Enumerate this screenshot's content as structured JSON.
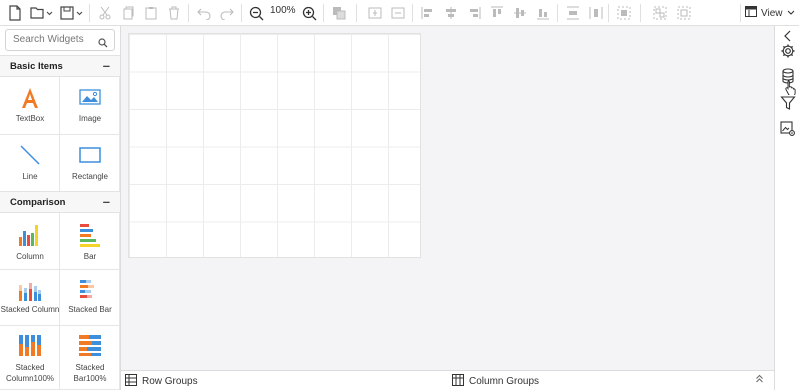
{
  "toolbar": {
    "zoom_level": "100%",
    "view_label": "View"
  },
  "widgets": {
    "search_placeholder": "Search Widgets",
    "sections": [
      {
        "title": "Basic Items",
        "items": [
          {
            "label": "TextBox",
            "icon": "textbox-icon"
          },
          {
            "label": "Image",
            "icon": "image-icon"
          },
          {
            "label": "Line",
            "icon": "line-icon"
          },
          {
            "label": "Rectangle",
            "icon": "rectangle-icon"
          }
        ]
      },
      {
        "title": "Comparison",
        "items": [
          {
            "label": "Column",
            "icon": "column-chart-icon"
          },
          {
            "label": "Bar",
            "icon": "bar-chart-icon"
          },
          {
            "label": "Stacked Column",
            "icon": "stacked-column-icon"
          },
          {
            "label": "Stacked Bar",
            "icon": "stacked-bar-icon"
          },
          {
            "label": "Stacked Column100%",
            "icon": "stacked-column-100-icon"
          },
          {
            "label": "Stacked Bar100%",
            "icon": "stacked-bar-100-icon"
          }
        ]
      }
    ]
  },
  "bottom_bar": {
    "row_groups": "Row Groups",
    "column_groups": "Column Groups"
  },
  "colors": {
    "accent_blue": "#3d8fdb",
    "orange": "#f07b24",
    "green": "#5cb85c",
    "yellow": "#f5d327",
    "red": "#e84c3d"
  }
}
